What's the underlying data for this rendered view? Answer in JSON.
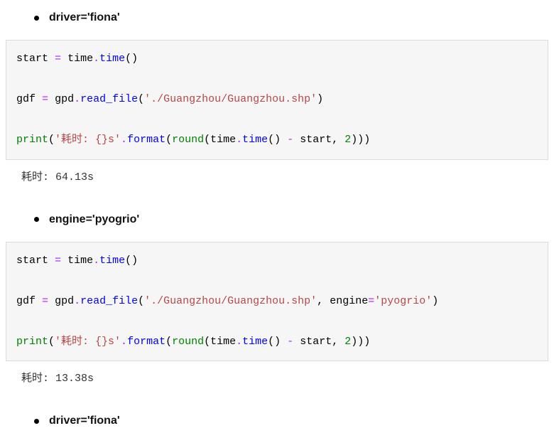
{
  "sections": [
    {
      "bullet": "driver='fiona'",
      "code_lines": [
        [
          {
            "t": "start",
            "c": "tk-nam"
          },
          {
            "t": " ",
            "c": "tk-pun"
          },
          {
            "t": "=",
            "c": "tk-op"
          },
          {
            "t": " ",
            "c": "tk-pun"
          },
          {
            "t": "time",
            "c": "tk-nam"
          },
          {
            "t": ".",
            "c": "tk-op"
          },
          {
            "t": "time",
            "c": "tk-fn"
          },
          {
            "t": "()",
            "c": "tk-pun"
          }
        ],
        [],
        [
          {
            "t": "gdf",
            "c": "tk-nam"
          },
          {
            "t": " ",
            "c": "tk-pun"
          },
          {
            "t": "=",
            "c": "tk-op"
          },
          {
            "t": " ",
            "c": "tk-pun"
          },
          {
            "t": "gpd",
            "c": "tk-nam"
          },
          {
            "t": ".",
            "c": "tk-op"
          },
          {
            "t": "read_file",
            "c": "tk-fn"
          },
          {
            "t": "(",
            "c": "tk-pun"
          },
          {
            "t": "'./Guangzhou/Guangzhou.shp'",
            "c": "tk-str"
          },
          {
            "t": ")",
            "c": "tk-pun"
          }
        ],
        [],
        [
          {
            "t": "print",
            "c": "tk-builtin"
          },
          {
            "t": "(",
            "c": "tk-pun"
          },
          {
            "t": "'耗时: {}s'",
            "c": "tk-str"
          },
          {
            "t": ".",
            "c": "tk-op"
          },
          {
            "t": "format",
            "c": "tk-fn"
          },
          {
            "t": "(",
            "c": "tk-pun"
          },
          {
            "t": "round",
            "c": "tk-builtin"
          },
          {
            "t": "(",
            "c": "tk-pun"
          },
          {
            "t": "time",
            "c": "tk-nam"
          },
          {
            "t": ".",
            "c": "tk-op"
          },
          {
            "t": "time",
            "c": "tk-fn"
          },
          {
            "t": "()",
            "c": "tk-pun"
          },
          {
            "t": " ",
            "c": "tk-pun"
          },
          {
            "t": "-",
            "c": "tk-op"
          },
          {
            "t": " ",
            "c": "tk-pun"
          },
          {
            "t": "start",
            "c": "tk-nam"
          },
          {
            "t": ",",
            "c": "tk-pun"
          },
          {
            "t": " ",
            "c": "tk-pun"
          },
          {
            "t": "2",
            "c": "tk-num"
          },
          {
            "t": ")))",
            "c": "tk-pun"
          }
        ]
      ],
      "output": "耗时: 64.13s"
    },
    {
      "bullet": "engine='pyogrio'",
      "code_lines": [
        [
          {
            "t": "start",
            "c": "tk-nam"
          },
          {
            "t": " ",
            "c": "tk-pun"
          },
          {
            "t": "=",
            "c": "tk-op"
          },
          {
            "t": " ",
            "c": "tk-pun"
          },
          {
            "t": "time",
            "c": "tk-nam"
          },
          {
            "t": ".",
            "c": "tk-op"
          },
          {
            "t": "time",
            "c": "tk-fn"
          },
          {
            "t": "()",
            "c": "tk-pun"
          }
        ],
        [],
        [
          {
            "t": "gdf",
            "c": "tk-nam"
          },
          {
            "t": " ",
            "c": "tk-pun"
          },
          {
            "t": "=",
            "c": "tk-op"
          },
          {
            "t": " ",
            "c": "tk-pun"
          },
          {
            "t": "gpd",
            "c": "tk-nam"
          },
          {
            "t": ".",
            "c": "tk-op"
          },
          {
            "t": "read_file",
            "c": "tk-fn"
          },
          {
            "t": "(",
            "c": "tk-pun"
          },
          {
            "t": "'./Guangzhou/Guangzhou.shp'",
            "c": "tk-str"
          },
          {
            "t": ",",
            "c": "tk-pun"
          },
          {
            "t": " ",
            "c": "tk-pun"
          },
          {
            "t": "engine",
            "c": "tk-nam"
          },
          {
            "t": "=",
            "c": "tk-op"
          },
          {
            "t": "'pyogrio'",
            "c": "tk-str"
          },
          {
            "t": ")",
            "c": "tk-pun"
          }
        ],
        [],
        [
          {
            "t": "print",
            "c": "tk-builtin"
          },
          {
            "t": "(",
            "c": "tk-pun"
          },
          {
            "t": "'耗时: {}s'",
            "c": "tk-str"
          },
          {
            "t": ".",
            "c": "tk-op"
          },
          {
            "t": "format",
            "c": "tk-fn"
          },
          {
            "t": "(",
            "c": "tk-pun"
          },
          {
            "t": "round",
            "c": "tk-builtin"
          },
          {
            "t": "(",
            "c": "tk-pun"
          },
          {
            "t": "time",
            "c": "tk-nam"
          },
          {
            "t": ".",
            "c": "tk-op"
          },
          {
            "t": "time",
            "c": "tk-fn"
          },
          {
            "t": "()",
            "c": "tk-pun"
          },
          {
            "t": " ",
            "c": "tk-pun"
          },
          {
            "t": "-",
            "c": "tk-op"
          },
          {
            "t": " ",
            "c": "tk-pun"
          },
          {
            "t": "start",
            "c": "tk-nam"
          },
          {
            "t": ",",
            "c": "tk-pun"
          },
          {
            "t": " ",
            "c": "tk-pun"
          },
          {
            "t": "2",
            "c": "tk-num"
          },
          {
            "t": ")))",
            "c": "tk-pun"
          }
        ]
      ],
      "output": "耗时: 13.38s"
    },
    {
      "bullet": "driver='fiona'",
      "code_lines": null,
      "output": null
    }
  ]
}
